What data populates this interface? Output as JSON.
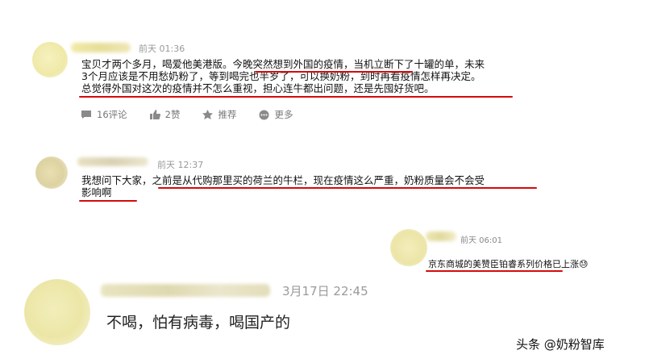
{
  "comments": [
    {
      "time": "前天 01:36",
      "lines": [
        "宝贝才两个多月，喝爱他美港版。今晚突然想到外国的疫情，当机立断下了十罐的单，未来",
        "3个月应该是不用愁奶粉了，等到喝完也半岁了，可以换奶粉，到时再看疫情怎样再决定。",
        "总觉得外国对这次的疫情并不怎么重视，担心连牛都出问题，还是先囤好货吧。"
      ],
      "actions": {
        "comments": "16评论",
        "likes": "2赞",
        "recommend": "推荐",
        "more": "更多"
      }
    },
    {
      "time": "前天 12:37",
      "lines": [
        "我想问下大家，之前是从代购那里买的荷兰的牛栏，现在疫情这么严重，奶粉质量会不会受",
        "影响啊"
      ]
    },
    {
      "time": "前天 06:01",
      "lines": [
        "京东商城的美赞臣铂睿系列价格已上涨"
      ],
      "emoji": "😓"
    },
    {
      "time": "3月17日 22:45",
      "lines": [
        "不喝，怕有病毒，喝国产的"
      ]
    }
  ],
  "watermark": "头条 @奶粉智库",
  "colors": {
    "underline": "#d40b0b",
    "time": "#999999",
    "avatar_yellow": "#f1ecb0"
  }
}
